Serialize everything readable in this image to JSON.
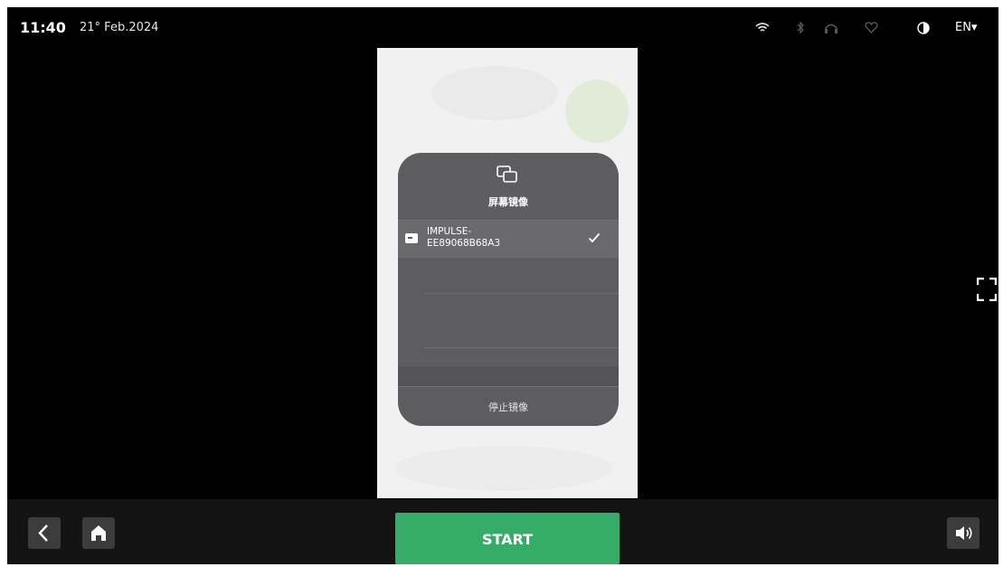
{
  "status_bar": {
    "time": "11:40",
    "date": "21° Feb.2024",
    "language": "EN▾",
    "icons": [
      "wifi-icon",
      "bluetooth-icon",
      "headset-icon",
      "heart-icon",
      "contrast-icon"
    ]
  },
  "mirror_panel": {
    "icon": "screen-mirroring-icon",
    "title": "屏幕镜像",
    "device_name": "IMPULSE-\nEE89068B68A3",
    "selected": true,
    "stop_label": "停止镜像"
  },
  "side": {
    "fullscreen_icon": "fullscreen-icon"
  },
  "bottom_bar": {
    "back_icon": "chevron-left-icon",
    "home_icon": "home-icon",
    "start_label": "START",
    "volume_icon": "volume-icon"
  },
  "colors": {
    "background": "#000000",
    "start_green": "#35ad68",
    "card_gray": "#5d5d61"
  }
}
